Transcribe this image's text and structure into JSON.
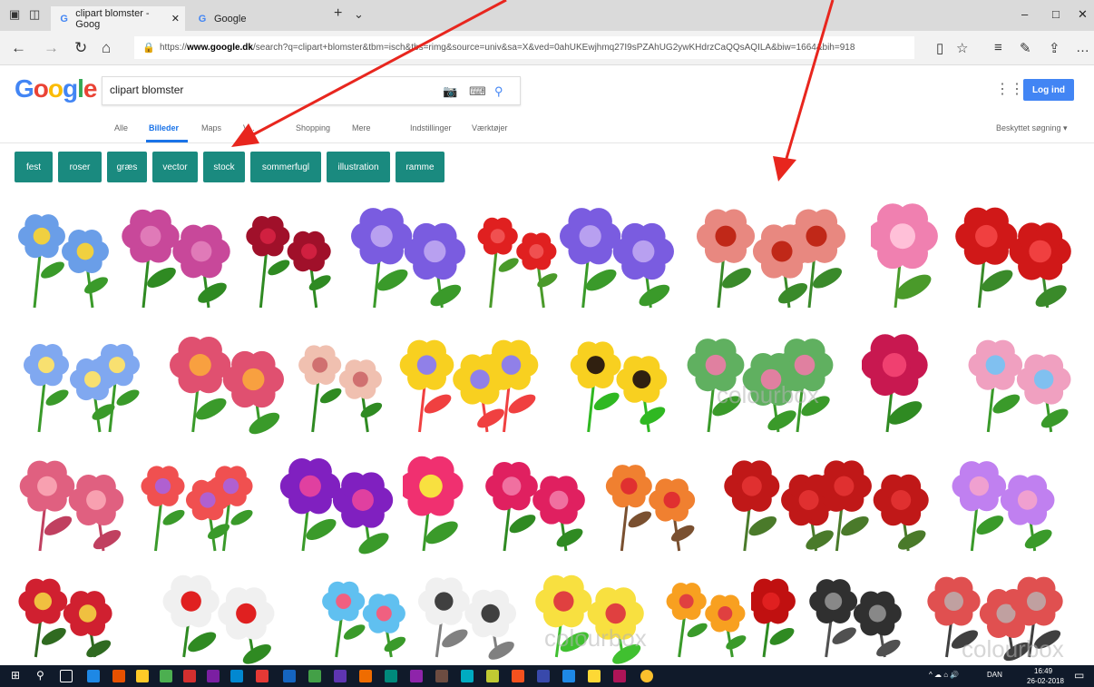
{
  "browser": {
    "tabs": [
      {
        "label": "clipart blomster - Goog",
        "icon": "G"
      },
      {
        "label": "Google",
        "icon": "G"
      }
    ],
    "url_prefix": "https://",
    "url_domain": "www.google.dk",
    "url_rest": "/search?q=clipart+blomster&tbm=isch&tbs=rimg&source=univ&sa=X&ved=0ahUKEwjhmq27I9sPZAhUG2ywKHdrzCaQQsAQILA&biw=1664&bih=918",
    "window_controls": [
      "–",
      "□",
      "✕"
    ]
  },
  "google": {
    "logo": [
      "G",
      "o",
      "o",
      "g",
      "l",
      "e"
    ],
    "logo_colors": [
      "#4285f4",
      "#ea4335",
      "#fbbc05",
      "#4285f4",
      "#34a853",
      "#ea4335"
    ],
    "query": "clipart blomster",
    "login": "Log ind",
    "nav": [
      "Alle",
      "Billeder",
      "Maps",
      "V...",
      "Shopping",
      "Mere",
      "Indstillinger",
      "Værktøjer"
    ],
    "safe_search": "Beskyttet søgning ▾"
  },
  "chips": [
    "fest",
    "roser",
    "græs",
    "vector",
    "stock",
    "sommerfugl",
    "illustration",
    "ramme"
  ],
  "images": [
    "blue-flower-bouquet",
    "pink-roses",
    "burgundy-roses",
    "violet-flower-border",
    "red-tulip",
    "violet-corner-border",
    "pink-red-roses",
    "pink-flower-bunch",
    "red-rose",
    "blue-flowers-ladybug",
    "mixed-flower-bouquet",
    "pastel-rose-bouquet",
    "sun-butterfly-cartoons",
    "sunflowers",
    "flower-frame-colourbox",
    "pink-rose-single",
    "flower-garden-stock",
    "rose-butterfly",
    "smiling-flowers",
    "purple-ribbon-flowers",
    "smiling-pink-flower",
    "pink-rose-leaves",
    "flower-tree",
    "long-stem-red-roses",
    "lilac-flowers",
    "flower-basket",
    "christmas-flower",
    "flower-vase",
    "line-art-flowers",
    "grass-flowers",
    "butterfly-swirl",
    "red-flower-stems",
    "black-white-flowers",
    "branch-colourbox"
  ],
  "watermarks": [
    "colourbox",
    "colourbox",
    "colourbox"
  ],
  "taskbar": {
    "tray_lang": "DAN",
    "time": "16:49",
    "date": "26-02-2018"
  },
  "colors": {
    "chip": "#1a8a7f",
    "accent": "#1a73e8",
    "arrow": "#e8261e",
    "taskbar": "#101a2a"
  }
}
